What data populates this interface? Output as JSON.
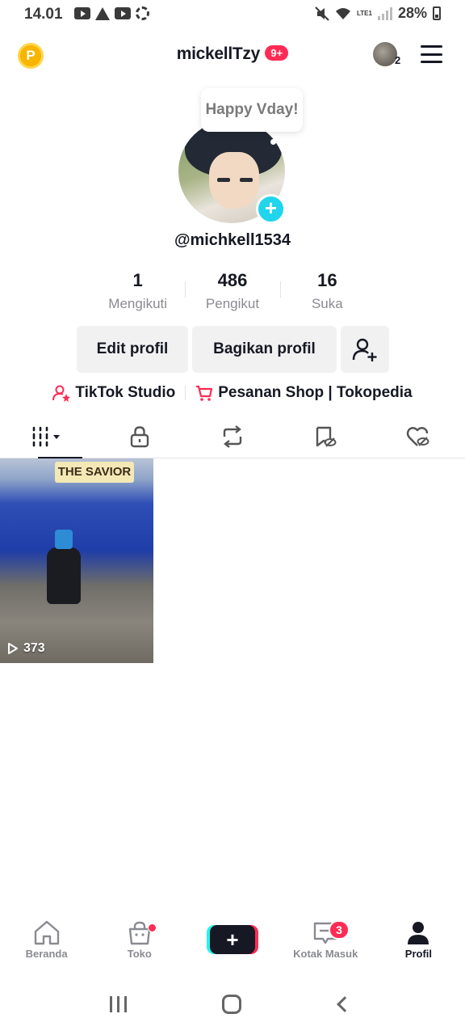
{
  "status_bar": {
    "time": "14.01",
    "battery_percent": "28%",
    "network": "LTE1"
  },
  "header": {
    "username": "mickellTzy",
    "notification_badge": "9+",
    "account_switch_count": "2"
  },
  "profile": {
    "bubble_text": "Happy Vday!",
    "handle": "@michkell1534"
  },
  "stats": [
    {
      "value": "1",
      "label": "Mengikuti"
    },
    {
      "value": "486",
      "label": "Pengikut"
    },
    {
      "value": "16",
      "label": "Suka"
    }
  ],
  "buttons": {
    "edit_profile": "Edit profil",
    "share_profile": "Bagikan profil"
  },
  "links": {
    "studio": "TikTok Studio",
    "shop": "Pesanan Shop | Tokopedia"
  },
  "tabs": [
    {
      "icon": "grid-videos-icon",
      "active": true
    },
    {
      "icon": "lock-icon",
      "active": false
    },
    {
      "icon": "repost-icon",
      "active": false
    },
    {
      "icon": "bookmark-hidden-icon",
      "active": false
    },
    {
      "icon": "liked-hidden-icon",
      "active": false
    }
  ],
  "videos": [
    {
      "banner": "THE SAVIOR",
      "views": "373"
    }
  ],
  "bottom_nav": {
    "home": "Beranda",
    "shop": "Toko",
    "inbox": "Kotak Masuk",
    "inbox_badge": "3",
    "profile": "Profil"
  },
  "colors": {
    "accent": "#fe2c55",
    "cyan": "#25f4ee",
    "text": "#161823",
    "muted": "#8a8b91"
  }
}
